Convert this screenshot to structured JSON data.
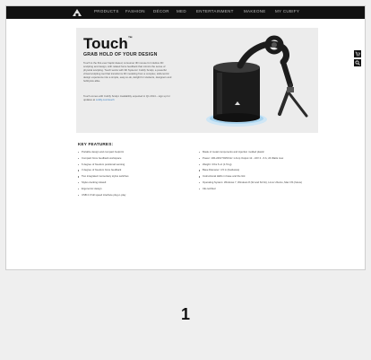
{
  "nav": {
    "items": [
      "PRODUCTS",
      "FASHION",
      "DÉCOR",
      "MED",
      "ENTERTAINMENT",
      "MAKEONE",
      "MY CUBIFY"
    ]
  },
  "hero": {
    "title": "Touch",
    "tm": "™",
    "subtitle": "GRAB HOLD OF YOUR DESIGN",
    "body": "Touch is the first-ever haptic-based, consumer 3D mouse for intuitive 3D sculpting and design, with related force feedback that mimics the sense of physical sculpting. Touch works with 3D Systems' Cubify Sculpt, a powerful virtual sculpting tool that transforms 3D modeling from a complex, skill-centric design experience into a simple, easy-to-do, delight for students, designers and hobbyists alike.",
    "body2": "Touch comes with Cubify Sculpt. Availability expected in Q1 2014 – sign up for updates at",
    "link": "cubify.com/touch"
  },
  "side_icons": [
    "cart-icon",
    "search-icon"
  ],
  "features": {
    "title": "KEY FEATURES:",
    "left": [
      "Portable design and compact footprint",
      "Compact force feedback workspace",
      "6 degree of freedom positional sensing",
      "3 degree of freedom force feedback",
      "Two integrated momentary stylus switches",
      "Stylus docking inkwell",
      "Ergonomic design",
      "USB 2.0 full speed interface plug-n-play"
    ],
    "right": [
      "Made of metal components and injection molded plastic",
      "Power: 100-240V 50/60 Hz 1 Amp Output 12 - 24V 2 - 6 A; 24 Watts max",
      "Weight: 3 lbs 6 oz (1.5 kg)",
      "Base Diameter: 4.5 in (hardware)",
      "Instructional LEDs in base and the link",
      "Operating System: Windows 7, Windows 8 (32 and 64 bit), Linux Ubuntu, Mac OS (future)",
      "CE certified"
    ]
  },
  "page_number": "1",
  "colors": {
    "nav_bg": "#111111",
    "hero_bg": "#ececec",
    "link": "#3a7fbf"
  }
}
